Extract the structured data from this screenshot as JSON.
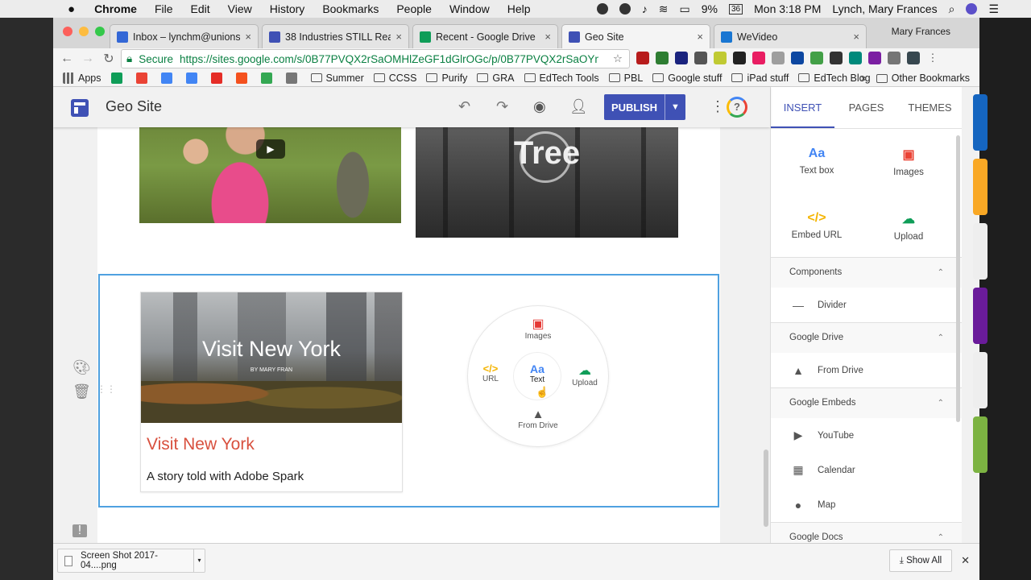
{
  "macos": {
    "app_name": "Chrome",
    "menus": [
      "File",
      "Edit",
      "View",
      "History",
      "Bookmarks",
      "People",
      "Window",
      "Help"
    ],
    "battery": "9%",
    "date_badge": "36",
    "clock": "Mon 3:18 PM",
    "user": "Lynch, Mary Frances"
  },
  "browser": {
    "tabs": [
      {
        "title": "Inbox – lynchm@unionsd.o",
        "color": "#3367d6"
      },
      {
        "title": "38 Industries STILL Ready",
        "color": "#3f51b5"
      },
      {
        "title": "Recent - Google Drive",
        "color": "#0f9d58"
      },
      {
        "title": "Geo Site",
        "color": "#3f51b5",
        "active": true
      },
      {
        "title": "WeVideo",
        "color": "#1976d2"
      }
    ],
    "profile": "Mary Frances",
    "secure_label": "Secure",
    "url": "https://sites.google.com/s/0B77PVQX2rSaOMHlZeGF1dGlrOGc/p/0B77PVQX2rSaOYnZ...",
    "bookmarks": [
      {
        "label": "Apps",
        "type": "apps"
      },
      {
        "label": "",
        "type": "icon",
        "color": "#0f9d58"
      },
      {
        "label": "",
        "type": "icon",
        "color": "#ea4335"
      },
      {
        "label": "",
        "type": "icon",
        "color": "#4285f4"
      },
      {
        "label": "",
        "type": "icon",
        "color": "#4285f4"
      },
      {
        "label": "",
        "type": "icon",
        "color": "#e52d27"
      },
      {
        "label": "",
        "type": "icon",
        "color": "#f4511e"
      },
      {
        "label": "",
        "type": "icon",
        "color": "#34a853"
      },
      {
        "label": "",
        "type": "icon",
        "color": "#777777"
      },
      {
        "label": "Summer",
        "type": "folder"
      },
      {
        "label": "CCSS",
        "type": "folder"
      },
      {
        "label": "Purify",
        "type": "folder"
      },
      {
        "label": "GRA",
        "type": "folder"
      },
      {
        "label": "EdTech Tools",
        "type": "folder"
      },
      {
        "label": "PBL",
        "type": "folder"
      },
      {
        "label": "Google stuff",
        "type": "folder"
      },
      {
        "label": "iPad stuff",
        "type": "folder"
      },
      {
        "label": "EdTech Blog",
        "type": "folder"
      }
    ],
    "other_bookmarks": "Other Bookmarks",
    "overflow": "»"
  },
  "sites": {
    "site_title": "Geo Site",
    "publish_label": "PUBLISH",
    "help_label": "?",
    "tree_text": "Tree",
    "card": {
      "image_title": "Visit New York",
      "image_byline": "BY MARY FRAN",
      "title": "Visit New York",
      "subtitle": "A story told with Adobe Spark"
    },
    "radial_menu": {
      "images": "Images",
      "url": "URL",
      "text": "Text",
      "text_icon": "Aa",
      "upload": "Upload",
      "from_drive": "From Drive"
    },
    "panel": {
      "tabs": [
        "INSERT",
        "PAGES",
        "THEMES"
      ],
      "quick": [
        {
          "label": "Text box",
          "icon": "Aa",
          "color": "#4285f4"
        },
        {
          "label": "Images",
          "icon": "▣",
          "color": "#ea4335"
        },
        {
          "label": "Embed URL",
          "icon": "</>",
          "color": "#f4b400"
        },
        {
          "label": "Upload",
          "icon": "☁",
          "color": "#0f9d58"
        }
      ],
      "groups": [
        {
          "title": "Components",
          "items": [
            {
              "label": "Divider",
              "icon": "—"
            }
          ]
        },
        {
          "title": "Google Drive",
          "items": [
            {
              "label": "From Drive",
              "icon": "▲"
            }
          ]
        },
        {
          "title": "Google Embeds",
          "items": [
            {
              "label": "YouTube",
              "icon": "▶"
            },
            {
              "label": "Calendar",
              "icon": "▦"
            },
            {
              "label": "Map",
              "icon": "●"
            }
          ]
        },
        {
          "title": "Google Docs",
          "items": []
        }
      ]
    }
  },
  "downloads": {
    "file": "Screen Shot 2017-04....png",
    "show_all": "Show All"
  }
}
